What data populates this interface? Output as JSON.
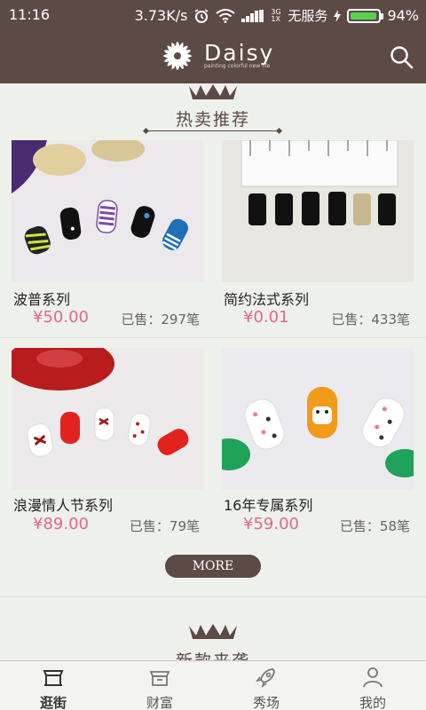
{
  "status_bar": {
    "time": "11:16",
    "network_speed": "3.73K/s",
    "signal_text": "3G 1X",
    "service": "无服务",
    "battery": "94%",
    "battery_level": 0.94
  },
  "header": {
    "brand": "Daisy",
    "tagline": "painting colorful new life",
    "search_icon": "search-icon",
    "bg_color": "#5c4a45"
  },
  "hot_section": {
    "title": "热卖推荐"
  },
  "products": [
    {
      "name": "波普系列",
      "price": "¥50.00",
      "sold": "已售：297笔"
    },
    {
      "name": "简约法式系列",
      "price": "¥0.01",
      "sold": "已售：433笔"
    },
    {
      "name": "浪漫情人节系列",
      "price": "¥89.00",
      "sold": "已售：79笔"
    },
    {
      "name": "16年专属系列",
      "price": "¥59.00",
      "sold": "已售：58笔"
    }
  ],
  "more_label": "MORE",
  "new_section": {
    "title": "新款来袭"
  },
  "tabs": [
    {
      "label": "逛街",
      "icon": "shop-icon",
      "active": true
    },
    {
      "label": "财富",
      "icon": "wallet-icon",
      "active": false
    },
    {
      "label": "秀场",
      "icon": "rocket-icon",
      "active": false
    },
    {
      "label": "我的",
      "icon": "person-icon",
      "active": false
    }
  ],
  "colors": {
    "accent": "#5c4a45",
    "price": "#e06a85",
    "background": "#eef0ec"
  }
}
